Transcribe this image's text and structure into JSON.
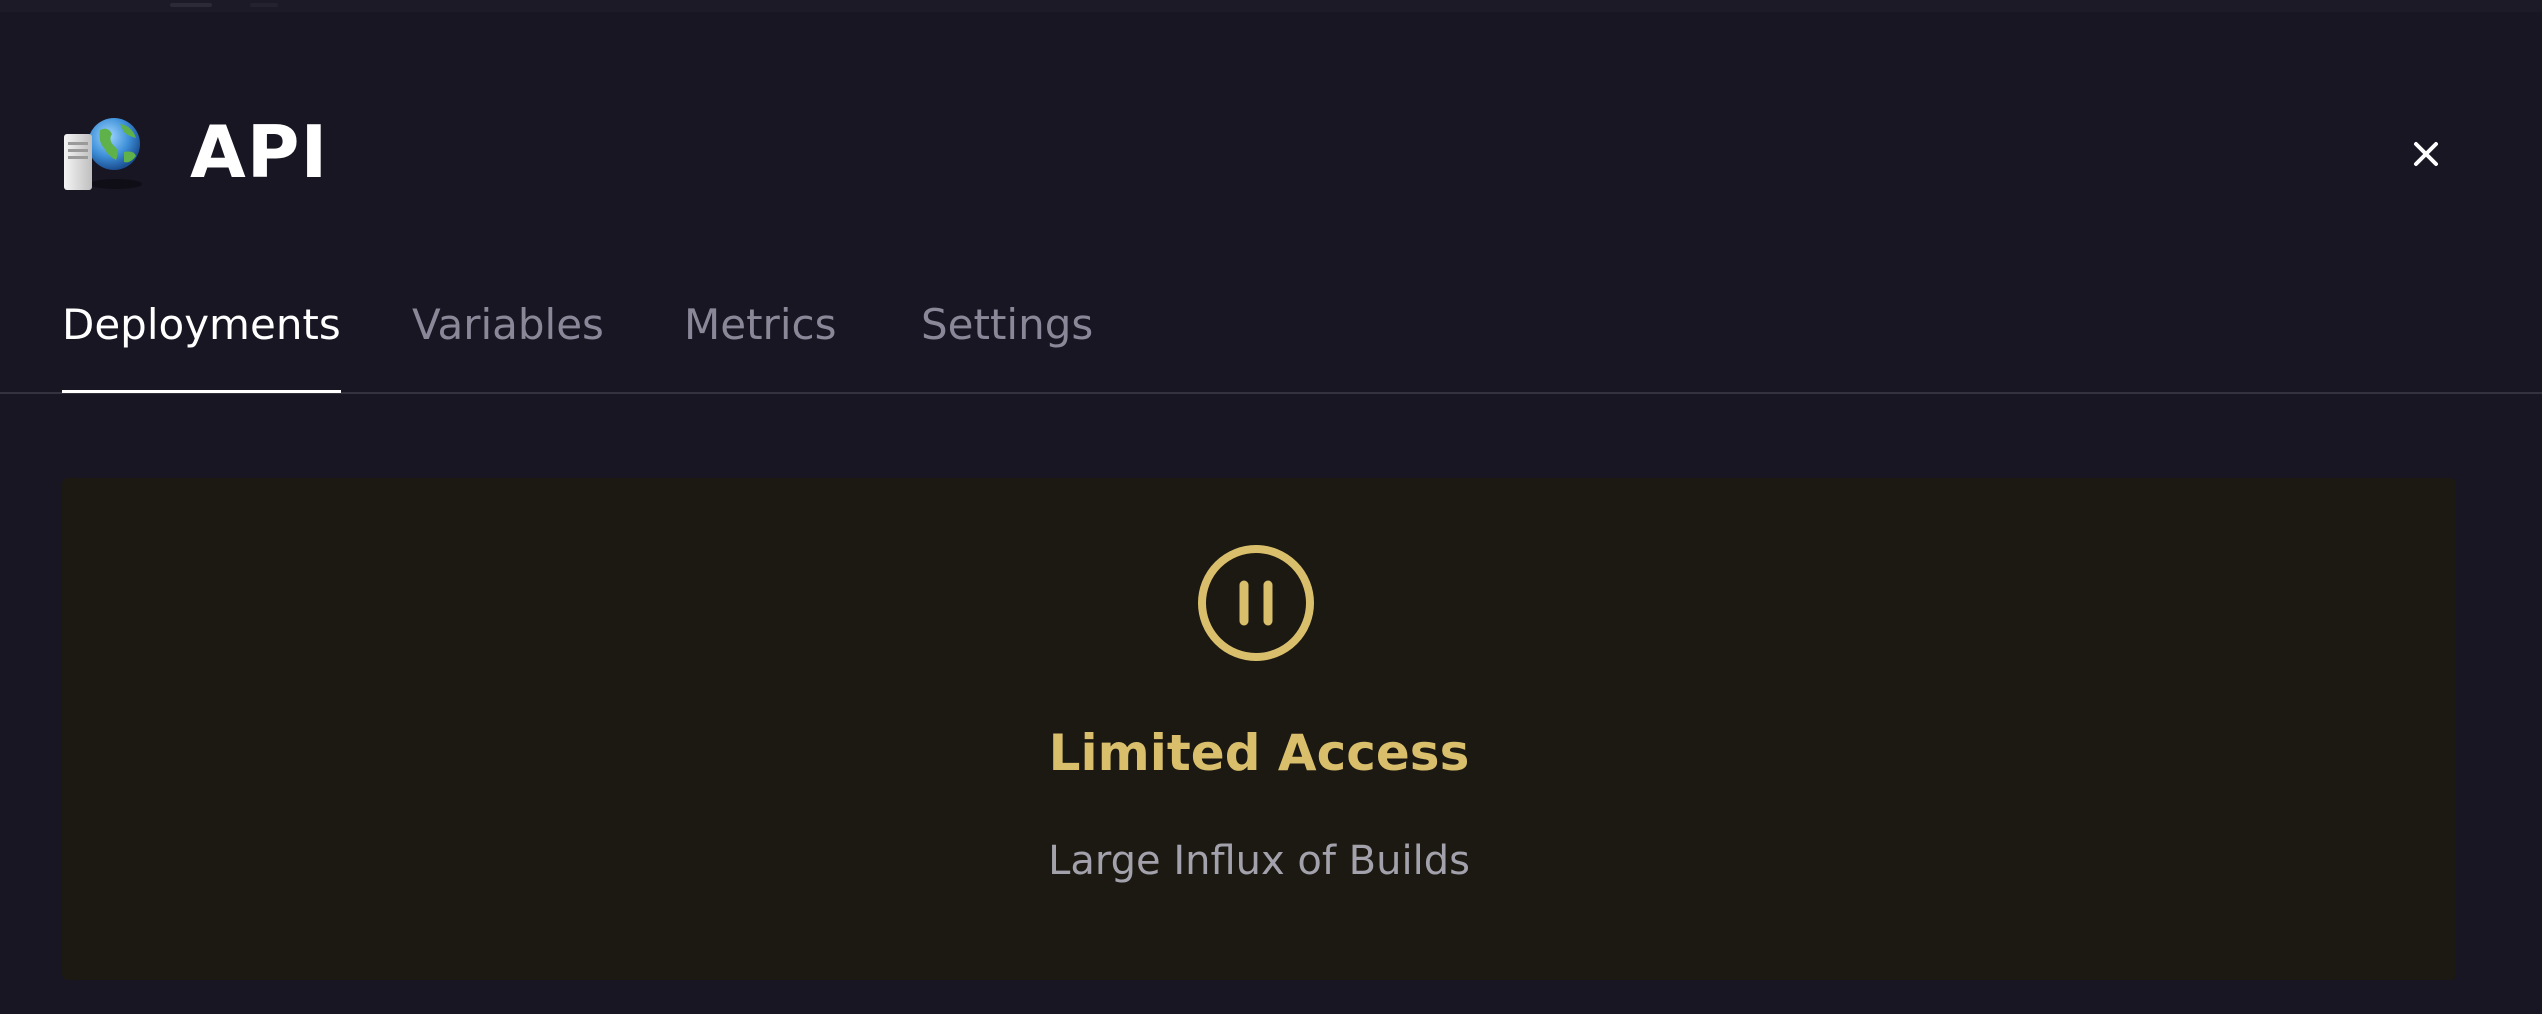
{
  "service": {
    "title": "API",
    "icon": "server-globe-icon"
  },
  "header": {
    "close_icon": "close-icon"
  },
  "tabs": [
    {
      "label": "Deployments",
      "active": true
    },
    {
      "label": "Variables",
      "active": false
    },
    {
      "label": "Metrics",
      "active": false
    },
    {
      "label": "Settings",
      "active": false
    }
  ],
  "notice": {
    "icon": "pause-circle-icon",
    "title": "Limited Access",
    "subtitle": "Large Influx of Builds",
    "accent_color": "#d9bf6b",
    "background_color": "#1c1912"
  },
  "colors": {
    "background": "#181622",
    "text_primary": "#ffffff",
    "text_muted": "#8a8799"
  }
}
